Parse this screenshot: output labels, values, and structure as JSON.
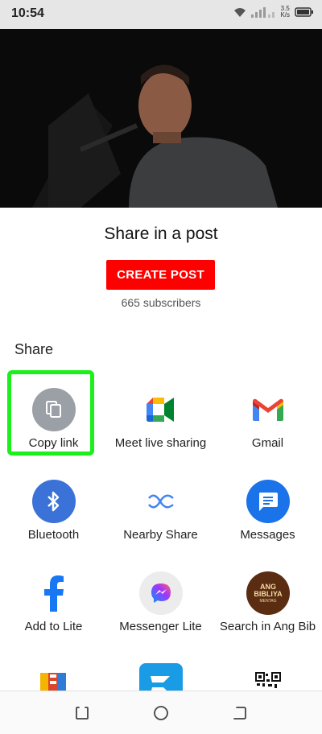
{
  "status_bar": {
    "time": "10:54",
    "speed_value": "3.5",
    "speed_unit": "K/s"
  },
  "share_post": {
    "title": "Share in a post",
    "button": "CREATE POST",
    "subscribers": "665 subscribers"
  },
  "share": {
    "heading": "Share",
    "apps": [
      {
        "label": "Copy link",
        "icon": "copy-icon"
      },
      {
        "label": "Meet live sharing",
        "icon": "meet-icon"
      },
      {
        "label": "Gmail",
        "icon": "gmail-icon"
      },
      {
        "label": "Bluetooth",
        "icon": "bluetooth-icon"
      },
      {
        "label": "Nearby Share",
        "icon": "nearby-share-icon"
      },
      {
        "label": "Messages",
        "icon": "messages-icon"
      },
      {
        "label": "Add to Lite",
        "icon": "facebook-icon"
      },
      {
        "label": "Messenger Lite",
        "icon": "messenger-icon"
      },
      {
        "label": "Search in Ang Bib",
        "icon": "ang-bibliya-icon"
      }
    ],
    "bible_icon_text": [
      "ANG",
      "BIBLIYA",
      "MENTAG"
    ]
  },
  "colors": {
    "create_post": "#ff0000",
    "highlight": "#1bf01b",
    "bluetooth": "#3a72d8",
    "messages": "#1a73e8"
  }
}
